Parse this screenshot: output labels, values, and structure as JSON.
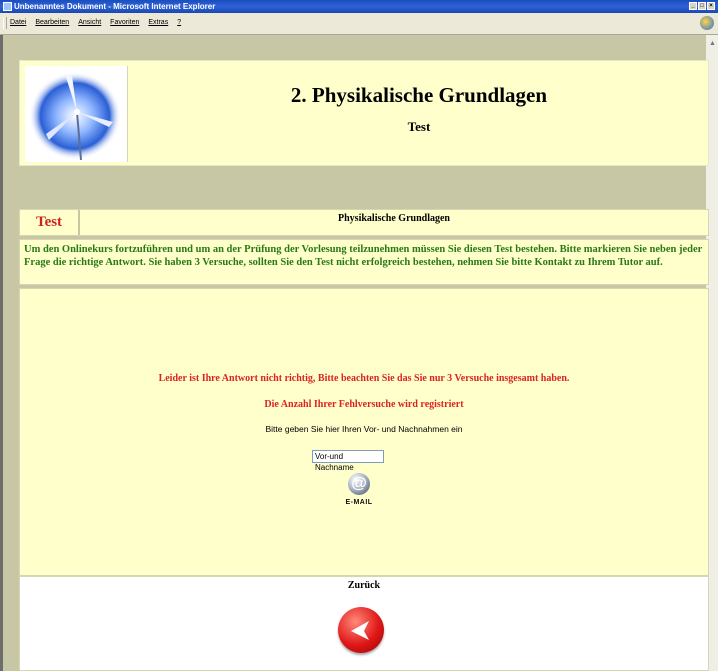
{
  "window": {
    "title": "Unbenanntes Dokument - Microsoft Internet Explorer",
    "controls": [
      "_",
      "□",
      "×"
    ]
  },
  "menu": {
    "items": [
      "Datei",
      "Bearbeiten",
      "Ansicht",
      "Favoriten",
      "Extras",
      "?"
    ]
  },
  "header": {
    "title": "2. Physikalische Grundlagen",
    "subtitle": "Test",
    "logo_icon": "wind-turbine-logo-icon"
  },
  "tab": {
    "label": "Test",
    "heading": "Physikalische Grundlagen"
  },
  "intro": {
    "text": "Um den Onlinekurs fortzuführen und um an der Prüfung der Vorlesung teilzunehmen müssen Sie diesen Test bestehen. Bitte markieren Sie neben jeder Frage die richtige Antwort. Sie haben 3 Versuche, sollten Sie den Test nicht erfolgreich bestehen, nehmen Sie bitte Kontakt zu Ihrem Tutor auf."
  },
  "feedback": {
    "error_message": "Leider ist Ihre Antwort nicht richtig, Bitte beachten Sie das Sie nur 3 Versuche insgesamt haben.",
    "registered_message": "Die Anzahl Ihrer Fehlversuche wird registriert",
    "name_prompt": "Bitte geben Sie hier Ihren Vor- und Nachnahmen ein",
    "name_value": "Vor-und Nachname",
    "email_label": "E-MAIL"
  },
  "footer": {
    "back_label": "Zurück"
  },
  "colors": {
    "page_bg": "#c8c7a5",
    "panel_bg": "#ffffcc",
    "intro_text": "#2a7a14",
    "error_text": "#dd2222"
  }
}
